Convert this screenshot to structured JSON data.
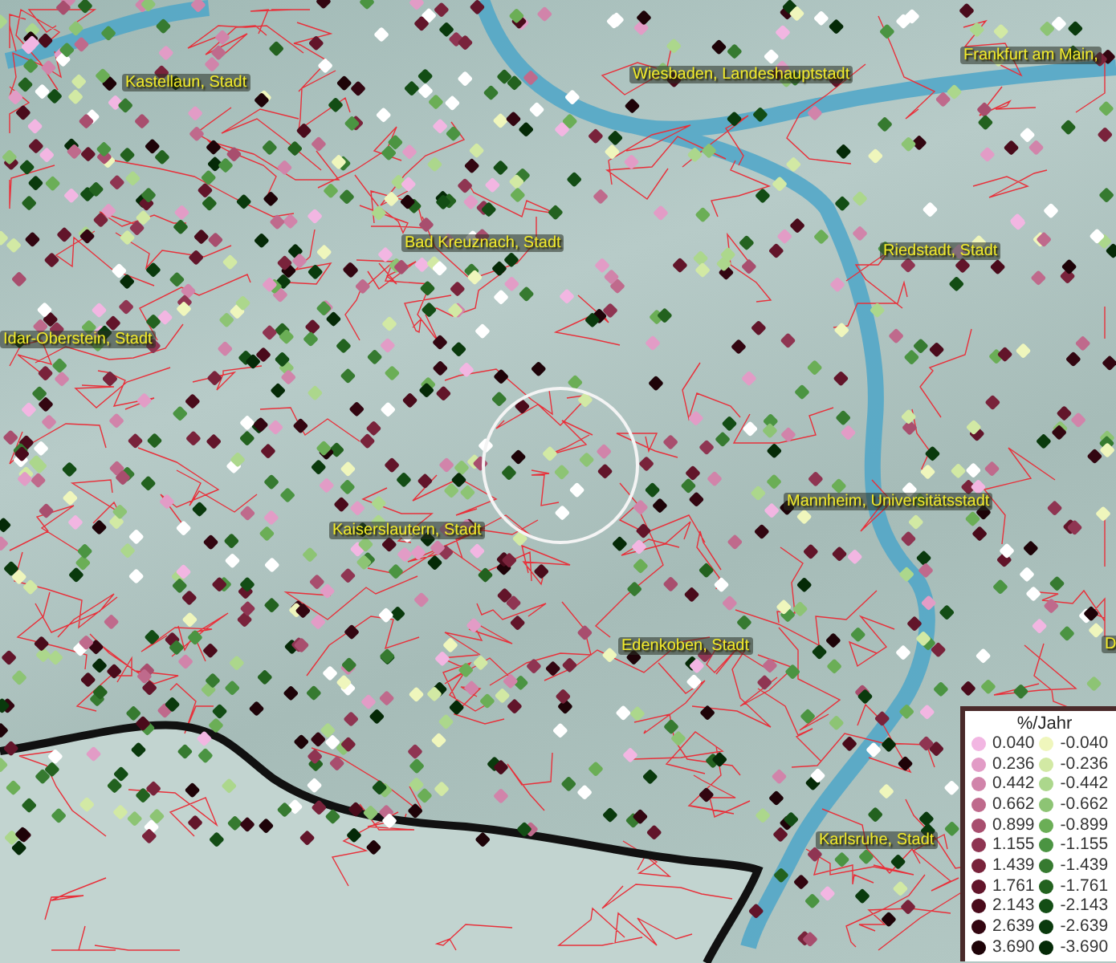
{
  "map": {
    "places": [
      {
        "name": "Kastellaun, Stadt"
      },
      {
        "name": "Wiesbaden, Landeshauptstadt"
      },
      {
        "name": "Frankfurt am Main,"
      },
      {
        "name": "Bad Kreuznach, Stadt"
      },
      {
        "name": "Riedstadt, Stadt"
      },
      {
        "name": "Idar-Oberstein, Stadt"
      },
      {
        "name": "Kaiserslautern, Stadt"
      },
      {
        "name": "Mannheim, Universitätsstadt"
      },
      {
        "name": "Edenkoben, Stadt"
      },
      {
        "name": "Karlsruhe, Stadt"
      },
      {
        "name": "D"
      }
    ]
  },
  "legend": {
    "title": "%/Jahr",
    "positive": [
      {
        "label": "0.040",
        "color": "#f2b6e2"
      },
      {
        "label": "0.236",
        "color": "#e29cc6"
      },
      {
        "label": "0.442",
        "color": "#d184aa"
      },
      {
        "label": "0.662",
        "color": "#bf6a8c"
      },
      {
        "label": "0.899",
        "color": "#a84e6e"
      },
      {
        "label": "1.155",
        "color": "#8f3552"
      },
      {
        "label": "1.439",
        "color": "#79233b"
      },
      {
        "label": "1.761",
        "color": "#62152a"
      },
      {
        "label": "2.143",
        "color": "#4a0b1b"
      },
      {
        "label": "2.639",
        "color": "#330611"
      },
      {
        "label": "3.690",
        "color": "#1e0308"
      }
    ],
    "negative": [
      {
        "label": "-0.040",
        "color": "#eff6bc"
      },
      {
        "label": "-0.236",
        "color": "#d2e9a4"
      },
      {
        "label": "-0.442",
        "color": "#acd78c"
      },
      {
        "label": "-0.662",
        "color": "#8dc474"
      },
      {
        "label": "-0.899",
        "color": "#6bae56"
      },
      {
        "label": "-1.155",
        "color": "#4b9442"
      },
      {
        "label": "-1.439",
        "color": "#367a30"
      },
      {
        "label": "-1.761",
        "color": "#23621f"
      },
      {
        "label": "-2.143",
        "color": "#134d15"
      },
      {
        "label": "-2.639",
        "color": "#0a3a0d"
      },
      {
        "label": "-3.690",
        "color": "#052a07"
      }
    ]
  }
}
